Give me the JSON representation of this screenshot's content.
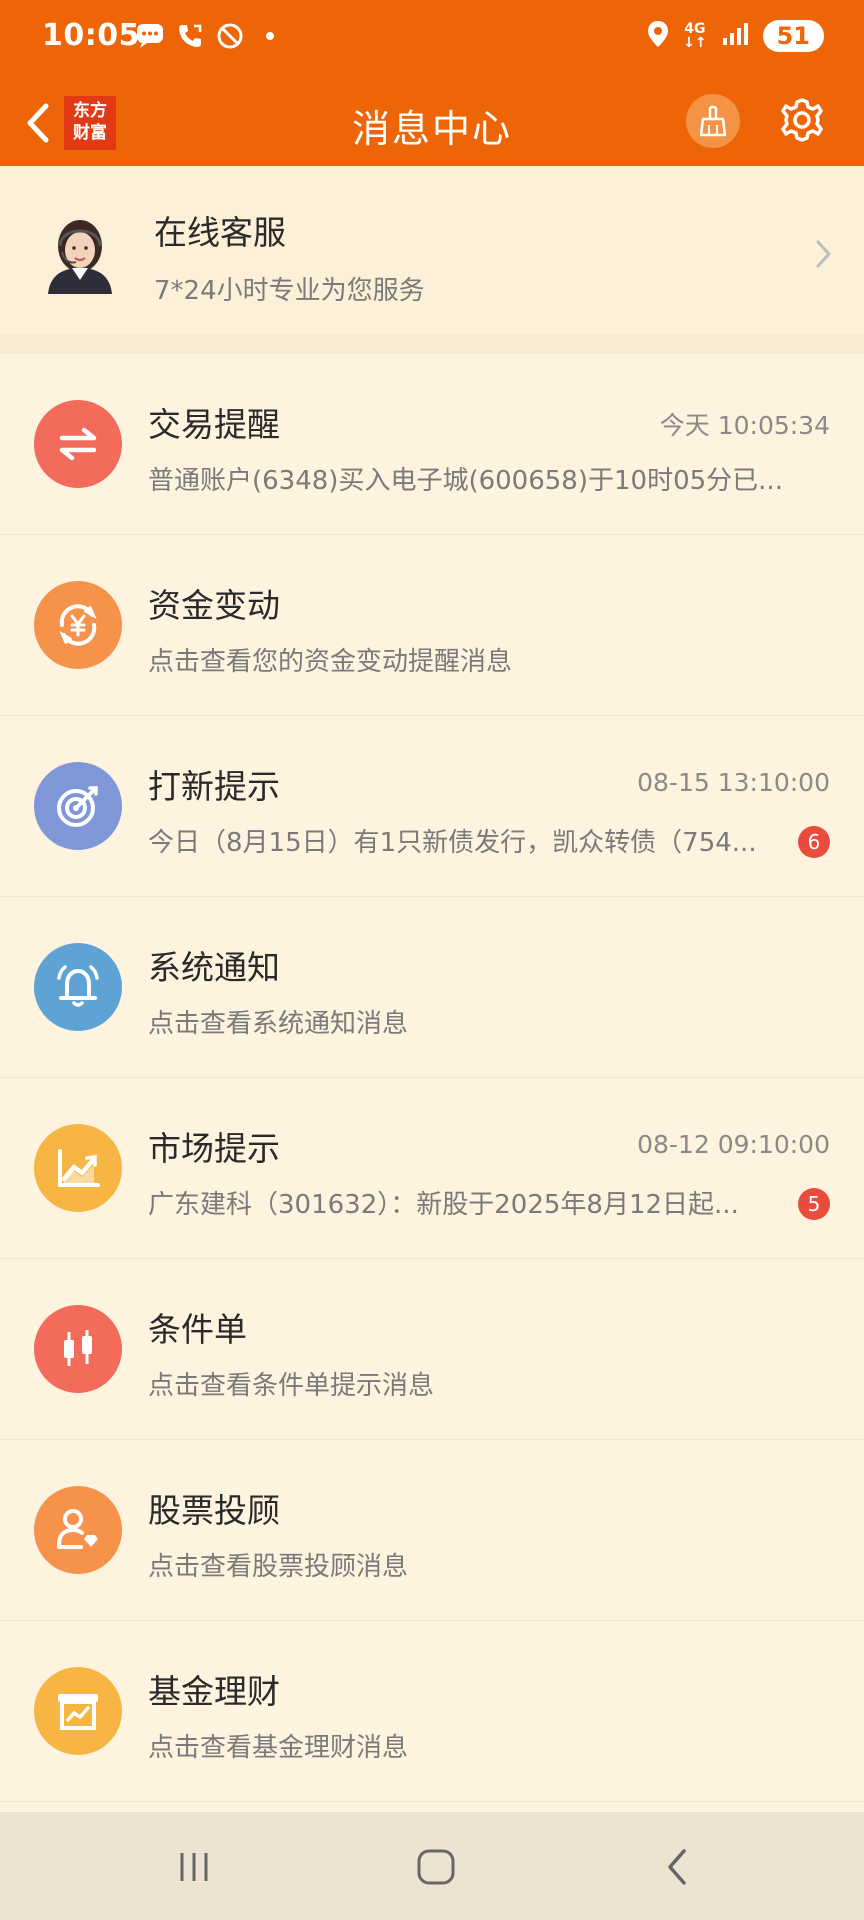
{
  "status_bar": {
    "time": "10:05",
    "network": "4G",
    "battery": "51"
  },
  "header": {
    "title": "消息中心",
    "logo_line1": "东方",
    "logo_line2": "财富"
  },
  "service": {
    "title": "在线客服",
    "subtitle": "7*24小时专业为您服务"
  },
  "items": [
    {
      "title": "交易提醒",
      "time": "今天 10:05:34",
      "subtitle": "普通账户(6348)买入电子城(600658)于10时05分已...",
      "badge": "",
      "icon": "exchange-icon",
      "color": "#F26B5B"
    },
    {
      "title": "资金变动",
      "time": "",
      "subtitle": "点击查看您的资金变动提醒消息",
      "badge": "",
      "icon": "yuan-cycle-icon",
      "color": "#F7924B"
    },
    {
      "title": "打新提示",
      "time": "08-15 13:10:00",
      "subtitle": "今日（8月15日）有1只新债发行，凯众转债（754...",
      "badge": "6",
      "icon": "target-icon",
      "color": "#7F97D6"
    },
    {
      "title": "系统通知",
      "time": "",
      "subtitle": "点击查看系统通知消息",
      "badge": "",
      "icon": "bell-icon",
      "color": "#5FA3D6"
    },
    {
      "title": "市场提示",
      "time": "08-12 09:10:00",
      "subtitle": "广东建科（301632）：新股于2025年8月12日起...",
      "badge": "5",
      "icon": "trend-chart-icon",
      "color": "#F7B544"
    },
    {
      "title": "条件单",
      "time": "",
      "subtitle": "点击查看条件单提示消息",
      "badge": "",
      "icon": "candlestick-icon",
      "color": "#F26B5B"
    },
    {
      "title": "股票投顾",
      "time": "",
      "subtitle": "点击查看股票投顾消息",
      "badge": "",
      "icon": "advisor-icon",
      "color": "#F7924B"
    },
    {
      "title": "基金理财",
      "time": "",
      "subtitle": "点击查看基金理财消息",
      "badge": "",
      "icon": "fund-icon",
      "color": "#F7B544"
    }
  ]
}
